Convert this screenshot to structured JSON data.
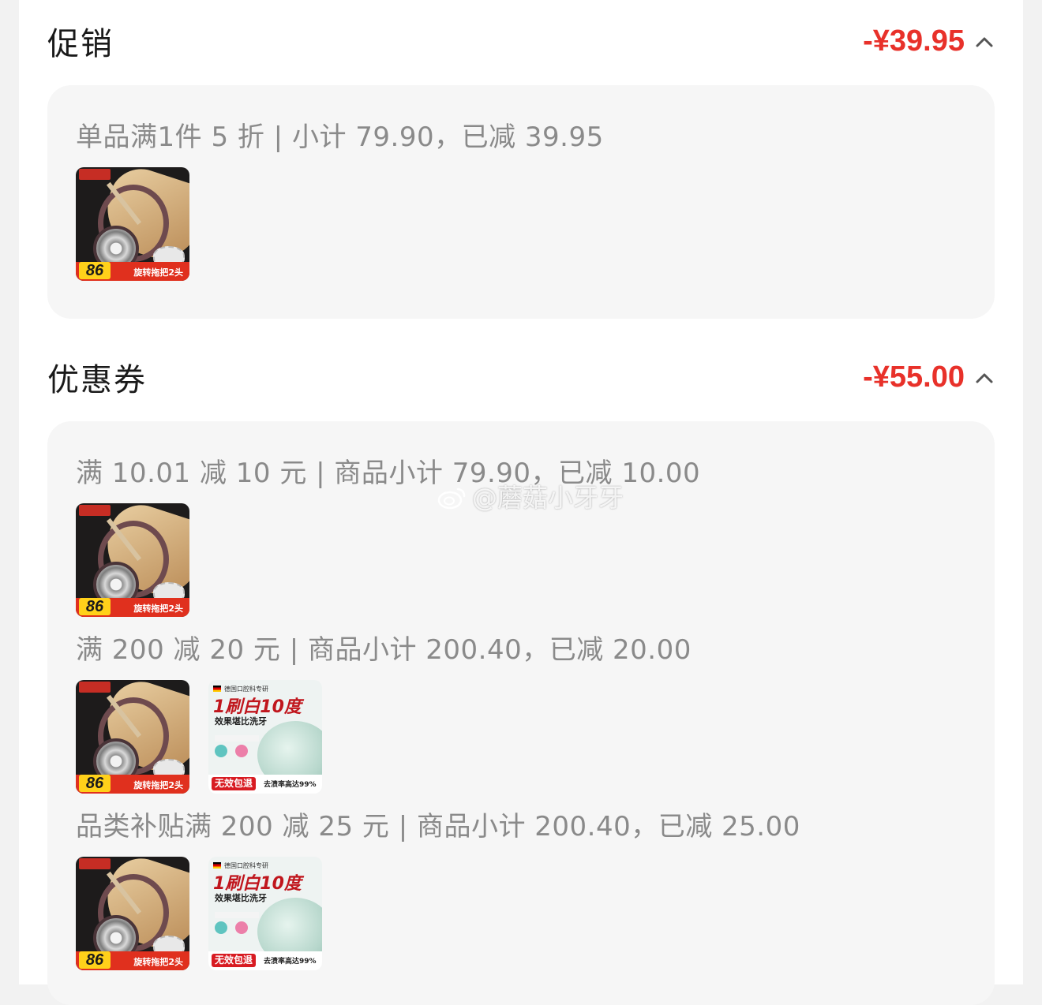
{
  "promotion": {
    "title": "促销",
    "amount": "-¥39.95",
    "rule": "单品满1件 5 折 | 小计 79.90，已减 39.95",
    "product": {
      "badge_num": "86",
      "caption": "旋转拖把2头"
    }
  },
  "coupons": {
    "title": "优惠券",
    "amount": "-¥55.00",
    "items": [
      {
        "rule": "满 10.01 减 10 元 | 商品小计 79.90，已减 10.00"
      },
      {
        "rule": "满 200 减 20 元 | 商品小计 200.40，已减 20.00"
      },
      {
        "rule": "品类补贴满 200 减 25 元 | 商品小计 200.40，已减 25.00"
      }
    ]
  },
  "products": {
    "mop": {
      "badge_num": "86",
      "caption": "旋转拖把2头"
    },
    "toothpowder": {
      "headline": "1刷白10度",
      "sub": "效果堪比洗牙",
      "tag": "无效包退",
      "claim": "去渍率高达99%",
      "top": "德国口腔科专研"
    }
  },
  "watermark": "@蘑菇小牙牙",
  "colors": {
    "accent": "#e8312a",
    "card_bg": "#f6f6f6"
  }
}
